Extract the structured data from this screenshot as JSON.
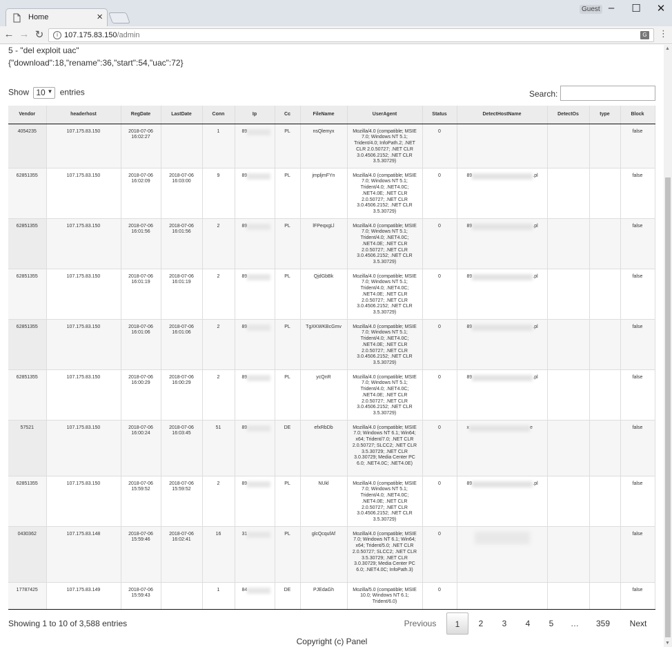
{
  "browser": {
    "tab_title": "Home",
    "tab_close": "×",
    "guest_label": "Guest",
    "url_host": "107.175.83.150",
    "url_path": "/admin",
    "translate_glyph": "G"
  },
  "page": {
    "command_line": "5 - \"del exploit uac\"",
    "json_line": "{\"download\":18,\"rename\":36,\"start\":54,\"uac\":72}",
    "show_prefix": "Show",
    "show_value": "10",
    "show_suffix": "entries",
    "search_label": "Search:",
    "search_value": ""
  },
  "table": {
    "columns": [
      "Vendor",
      "headerhost",
      "RegDate",
      "LastDate",
      "Conn",
      "Ip",
      "Cc",
      "FileName",
      "UserAgent",
      "Status",
      "DetectHostName",
      "DetectOs",
      "type",
      "Block"
    ],
    "rows": [
      {
        "vendor": "4054235",
        "headerhost": "107.175.83.150",
        "regdate": "2018-07-06 16:02:27",
        "lastdate": "",
        "conn": "1",
        "ip": "89",
        "cc": "PL",
        "filename": "nsQlemyx",
        "useragent": "Mozilla/4.0 (compatible; MSIE 7.0; Windows NT 5.1; Trident/4.0; InfoPath.2; .NET CLR 2.0.50727; .NET CLR 3.0.4506.2152; .NET CLR 3.5.30729)",
        "status": "0",
        "detecthost_prefix": "",
        "detecthost_suffix": "",
        "detectos": "",
        "type": "",
        "block": "false"
      },
      {
        "vendor": "62851355",
        "headerhost": "107.175.83.150",
        "regdate": "2018-07-06 16:02:09",
        "lastdate": "2018-07-06 16:03:00",
        "conn": "9",
        "ip": "89",
        "cc": "PL",
        "filename": "jmpljmFYn",
        "useragent": "Mozilla/4.0 (compatible; MSIE 7.0; Windows NT 5.1; Trident/4.0; .NET4.0C; .NET4.0E; .NET CLR 2.0.50727; .NET CLR 3.0.4506.2152; .NET CLR 3.5.30729)",
        "status": "0",
        "detecthost_prefix": "89",
        "detecthost_suffix": ".pl",
        "detectos": "",
        "type": "",
        "block": "false"
      },
      {
        "vendor": "62851355",
        "headerhost": "107.175.83.150",
        "regdate": "2018-07-06 16:01:56",
        "lastdate": "2018-07-06 16:01:56",
        "conn": "2",
        "ip": "89",
        "cc": "PL",
        "filename": "lFPeqxgLl",
        "useragent": "Mozilla/4.0 (compatible; MSIE 7.0; Windows NT 5.1; Trident/4.0; .NET4.0C; .NET4.0E; .NET CLR 2.0.50727; .NET CLR 3.0.4506.2152; .NET CLR 3.5.30729)",
        "status": "0",
        "detecthost_prefix": "89",
        "detecthost_suffix": ".pl",
        "detectos": "",
        "type": "",
        "block": "false"
      },
      {
        "vendor": "62851355",
        "headerhost": "107.175.83.150",
        "regdate": "2018-07-06 16:01:19",
        "lastdate": "2018-07-06 16:01:19",
        "conn": "2",
        "ip": "89",
        "cc": "PL",
        "filename": "QjdGbBk",
        "useragent": "Mozilla/4.0 (compatible; MSIE 7.0; Windows NT 5.1; Trident/4.0; .NET4.0C; .NET4.0E; .NET CLR 2.0.50727; .NET CLR 3.0.4506.2152; .NET CLR 3.5.30729)",
        "status": "0",
        "detecthost_prefix": "89",
        "detecthost_suffix": ".pl",
        "detectos": "",
        "type": "",
        "block": "false"
      },
      {
        "vendor": "62851355",
        "headerhost": "107.175.83.150",
        "regdate": "2018-07-06 16:01:06",
        "lastdate": "2018-07-06 16:01:06",
        "conn": "2",
        "ip": "89",
        "cc": "PL",
        "filename": "TgXKWKBcGmv",
        "useragent": "Mozilla/4.0 (compatible; MSIE 7.0; Windows NT 5.1; Trident/4.0; .NET4.0C; .NET4.0E; .NET CLR 2.0.50727; .NET CLR 3.0.4506.2152; .NET CLR 3.5.30729)",
        "status": "0",
        "detecthost_prefix": "89",
        "detecthost_suffix": ".pl",
        "detectos": "",
        "type": "",
        "block": "false"
      },
      {
        "vendor": "62851355",
        "headerhost": "107.175.83.150",
        "regdate": "2018-07-06 16:00:29",
        "lastdate": "2018-07-06 16:00:29",
        "conn": "2",
        "ip": "89",
        "cc": "PL",
        "filename": "ycQnR",
        "useragent": "Mozilla/4.0 (compatible; MSIE 7.0; Windows NT 5.1; Trident/4.0; .NET4.0C; .NET4.0E; .NET CLR 2.0.50727; .NET CLR 3.0.4506.2152; .NET CLR 3.5.30729)",
        "status": "0",
        "detecthost_prefix": "89",
        "detecthost_suffix": ".pl",
        "detectos": "",
        "type": "",
        "block": "false"
      },
      {
        "vendor": "57521",
        "headerhost": "107.175.83.150",
        "regdate": "2018-07-06 16:00:24",
        "lastdate": "2018-07-06 16:03:45",
        "conn": "51",
        "ip": "89",
        "cc": "DE",
        "filename": "efxRbDb",
        "useragent": "Mozilla/4.0 (compatible; MSIE 7.0; Windows NT 6.1; Win64; x64; Trident/7.0; .NET CLR 2.0.50727; SLCC2; .NET CLR 3.5.30729; .NET CLR 3.0.30729; Media Center PC 6.0; .NET4.0C; .NET4.0E)",
        "status": "0",
        "detecthost_prefix": "x",
        "detecthost_suffix": "e",
        "detectos": "",
        "type": "",
        "block": "false"
      },
      {
        "vendor": "62851355",
        "headerhost": "107.175.83.150",
        "regdate": "2018-07-06 15:59:52",
        "lastdate": "2018-07-06 15:59:52",
        "conn": "2",
        "ip": "89",
        "cc": "PL",
        "filename": "NUkl",
        "useragent": "Mozilla/4.0 (compatible; MSIE 7.0; Windows NT 5.1; Trident/4.0; .NET4.0C; .NET4.0E; .NET CLR 2.0.50727; .NET CLR 3.0.4506.2152; .NET CLR 3.5.30729)",
        "status": "0",
        "detecthost_prefix": "89",
        "detecthost_suffix": ".pl",
        "detectos": "",
        "type": "",
        "block": "false"
      },
      {
        "vendor": "0430362",
        "headerhost": "107.175.83.148",
        "regdate": "2018-07-06 15:59:46",
        "lastdate": "2018-07-06 16:02:41",
        "conn": "16",
        "ip": "31",
        "cc": "PL",
        "filename": "glcQcqufAf",
        "useragent": "Mozilla/4.0 (compatible; MSIE 7.0; Windows NT 6.1; Win64; x64; Trident/5.0; .NET CLR 2.0.50727; SLCC2; .NET CLR 3.5.30729; .NET CLR 3.0.30729; Media Center PC 6.0; .NET4.0C; InfoPath.3)",
        "status": "0",
        "detecthost_prefix": "",
        "detecthost_suffix": "",
        "detectos": "",
        "type": "",
        "block": "false"
      },
      {
        "vendor": "17787425",
        "headerhost": "107.175.83.149",
        "regdate": "2018-07-06 15:59:43",
        "lastdate": "",
        "conn": "1",
        "ip": "84",
        "cc": "DE",
        "filename": "PJEdaGh",
        "useragent": "Mozilla/5.0 (compatible; MSIE 10.0; Windows NT 6.1; Trident/6.0)",
        "status": "0",
        "detecthost_prefix": "",
        "detecthost_suffix": "",
        "detectos": "",
        "type": "",
        "block": "false"
      }
    ]
  },
  "footer": {
    "info": "Showing 1 to 10 of 3,588 entries",
    "previous": "Previous",
    "pages": [
      "1",
      "2",
      "3",
      "4",
      "5",
      "…",
      "359"
    ],
    "current_page": "1",
    "next": "Next",
    "copyright": "Copyright (c) Panel"
  }
}
